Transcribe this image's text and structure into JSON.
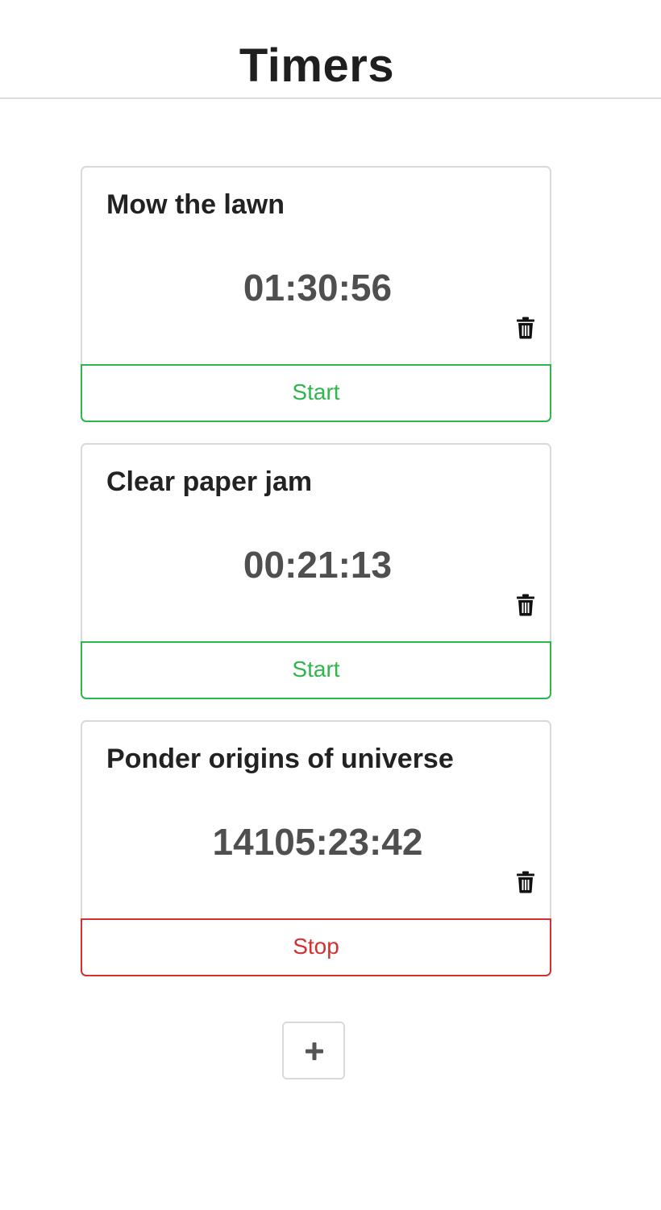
{
  "header": {
    "title": "Timers"
  },
  "timers": [
    {
      "title": "Mow the lawn",
      "elapsed": "01:30:56",
      "action_label": "Start",
      "action_kind": "start",
      "delete_icon": "trash-icon"
    },
    {
      "title": "Clear paper jam",
      "elapsed": "00:21:13",
      "action_label": "Start",
      "action_kind": "start",
      "delete_icon": "trash-icon"
    },
    {
      "title": "Ponder origins of universe",
      "elapsed": "14105:23:42",
      "action_label": "Stop",
      "action_kind": "stop",
      "delete_icon": "trash-icon"
    }
  ],
  "add_button": {
    "icon": "plus-icon"
  },
  "colors": {
    "start": "#2fb64a",
    "stop": "#d62f2f",
    "border": "#d9d9d9",
    "elapsed_text": "#4f4f4f"
  }
}
